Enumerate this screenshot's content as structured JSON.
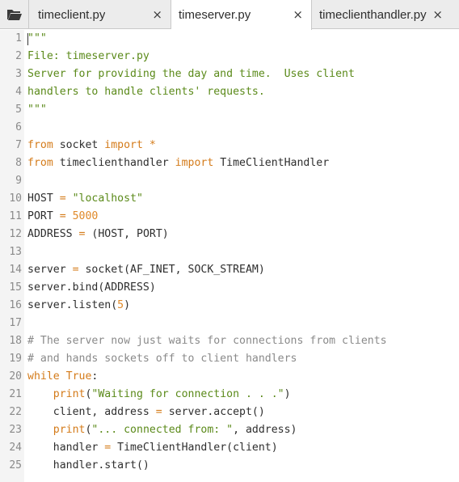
{
  "tabs": [
    {
      "label": "timeclient.py",
      "close": "×"
    },
    {
      "label": "timeserver.py",
      "close": "×"
    },
    {
      "label": "timeclienthandler.py",
      "close": "×"
    }
  ],
  "code_lines": [
    {
      "num": "1",
      "tokens": [
        {
          "t": "\"\"\"",
          "c": "str"
        }
      ]
    },
    {
      "num": "2",
      "tokens": [
        {
          "t": "File: timeserver.py",
          "c": "str"
        }
      ]
    },
    {
      "num": "3",
      "tokens": [
        {
          "t": "Server for providing the day and time.  Uses client",
          "c": "str"
        }
      ]
    },
    {
      "num": "4",
      "tokens": [
        {
          "t": "handlers to handle clients' requests.",
          "c": "str"
        }
      ]
    },
    {
      "num": "5",
      "tokens": [
        {
          "t": "\"\"\"",
          "c": "str"
        }
      ]
    },
    {
      "num": "6",
      "tokens": []
    },
    {
      "num": "7",
      "tokens": [
        {
          "t": "from",
          "c": "kw"
        },
        {
          "t": " socket ",
          "c": ""
        },
        {
          "t": "import",
          "c": "kw"
        },
        {
          "t": " ",
          "c": ""
        },
        {
          "t": "*",
          "c": "op"
        }
      ]
    },
    {
      "num": "8",
      "tokens": [
        {
          "t": "from",
          "c": "kw"
        },
        {
          "t": " timeclienthandler ",
          "c": ""
        },
        {
          "t": "import",
          "c": "kw"
        },
        {
          "t": " TimeClientHandler",
          "c": ""
        }
      ]
    },
    {
      "num": "9",
      "tokens": []
    },
    {
      "num": "10",
      "tokens": [
        {
          "t": "HOST ",
          "c": ""
        },
        {
          "t": "=",
          "c": "op"
        },
        {
          "t": " ",
          "c": ""
        },
        {
          "t": "\"localhost\"",
          "c": "str"
        }
      ]
    },
    {
      "num": "11",
      "tokens": [
        {
          "t": "PORT ",
          "c": ""
        },
        {
          "t": "=",
          "c": "op"
        },
        {
          "t": " ",
          "c": ""
        },
        {
          "t": "5000",
          "c": "num"
        }
      ]
    },
    {
      "num": "12",
      "tokens": [
        {
          "t": "ADDRESS ",
          "c": ""
        },
        {
          "t": "=",
          "c": "op"
        },
        {
          "t": " (HOST, PORT)",
          "c": ""
        }
      ]
    },
    {
      "num": "13",
      "tokens": []
    },
    {
      "num": "14",
      "tokens": [
        {
          "t": "server ",
          "c": ""
        },
        {
          "t": "=",
          "c": "op"
        },
        {
          "t": " socket(AF_INET, SOCK_STREAM)",
          "c": ""
        }
      ]
    },
    {
      "num": "15",
      "tokens": [
        {
          "t": "server.bind(ADDRESS)",
          "c": ""
        }
      ]
    },
    {
      "num": "16",
      "tokens": [
        {
          "t": "server.listen(",
          "c": ""
        },
        {
          "t": "5",
          "c": "num"
        },
        {
          "t": ")",
          "c": ""
        }
      ]
    },
    {
      "num": "17",
      "tokens": []
    },
    {
      "num": "18",
      "tokens": [
        {
          "t": "# The server now just waits for connections from clients",
          "c": "cm"
        }
      ]
    },
    {
      "num": "19",
      "tokens": [
        {
          "t": "# and hands sockets off to client handlers",
          "c": "cm"
        }
      ]
    },
    {
      "num": "20",
      "tokens": [
        {
          "t": "while",
          "c": "kw"
        },
        {
          "t": " ",
          "c": ""
        },
        {
          "t": "True",
          "c": "kw"
        },
        {
          "t": ":",
          "c": ""
        }
      ]
    },
    {
      "num": "21",
      "tokens": [
        {
          "t": "    ",
          "c": ""
        },
        {
          "t": "print",
          "c": "kw"
        },
        {
          "t": "(",
          "c": ""
        },
        {
          "t": "\"Waiting for connection . . .\"",
          "c": "str"
        },
        {
          "t": ")",
          "c": ""
        }
      ]
    },
    {
      "num": "22",
      "tokens": [
        {
          "t": "    client, address ",
          "c": ""
        },
        {
          "t": "=",
          "c": "op"
        },
        {
          "t": " server.accept()",
          "c": ""
        }
      ]
    },
    {
      "num": "23",
      "tokens": [
        {
          "t": "    ",
          "c": ""
        },
        {
          "t": "print",
          "c": "kw"
        },
        {
          "t": "(",
          "c": ""
        },
        {
          "t": "\"... connected from: \"",
          "c": "str"
        },
        {
          "t": ", address)",
          "c": ""
        }
      ]
    },
    {
      "num": "24",
      "tokens": [
        {
          "t": "    handler ",
          "c": ""
        },
        {
          "t": "=",
          "c": "op"
        },
        {
          "t": " TimeClientHandler(client)",
          "c": ""
        }
      ]
    },
    {
      "num": "25",
      "tokens": [
        {
          "t": "    handler.start()",
          "c": ""
        }
      ]
    }
  ]
}
